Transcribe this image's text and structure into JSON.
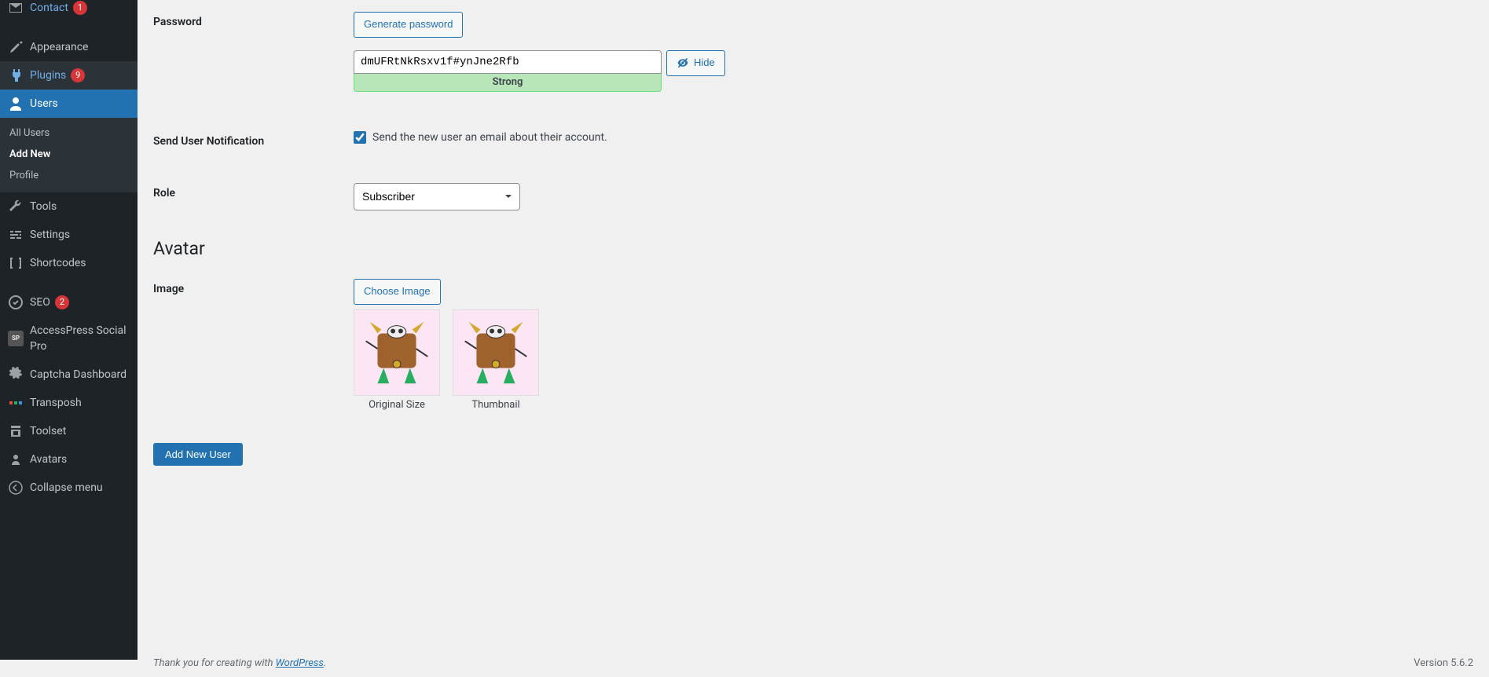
{
  "sidebar": {
    "contact": {
      "label": "Contact",
      "badge": "1"
    },
    "appearance": {
      "label": "Appearance"
    },
    "plugins": {
      "label": "Plugins",
      "badge": "9"
    },
    "users": {
      "label": "Users"
    },
    "users_sub": {
      "all": "All Users",
      "add": "Add New",
      "profile": "Profile"
    },
    "tools": {
      "label": "Tools"
    },
    "settings": {
      "label": "Settings"
    },
    "shortcodes": {
      "label": "Shortcodes"
    },
    "seo": {
      "label": "SEO",
      "badge": "2"
    },
    "accesspress": {
      "label": "AccessPress Social Pro"
    },
    "captcha": {
      "label": "Captcha Dashboard"
    },
    "transposh": {
      "label": "Transposh"
    },
    "toolset": {
      "label": "Toolset"
    },
    "avatars": {
      "label": "Avatars"
    },
    "collapse": {
      "label": "Collapse menu"
    }
  },
  "form": {
    "password_label": "Password",
    "generate_button": "Generate password",
    "password_value": "dmUFRtNkRsxv1f#ynJne2Rfb",
    "hide_button": "Hide",
    "strength": "Strong",
    "notification_label": "Send User Notification",
    "notification_text": "Send the new user an email about their account.",
    "notification_checked": true,
    "role_label": "Role",
    "role_value": "Subscriber",
    "avatar_heading": "Avatar",
    "image_label": "Image",
    "choose_image": "Choose Image",
    "original_caption": "Original Size",
    "thumbnail_caption": "Thumbnail",
    "submit": "Add New User"
  },
  "footer": {
    "thanks_pre": "Thank you for creating with ",
    "thanks_link": "WordPress",
    "thanks_post": ".",
    "version": "Version 5.6.2"
  }
}
